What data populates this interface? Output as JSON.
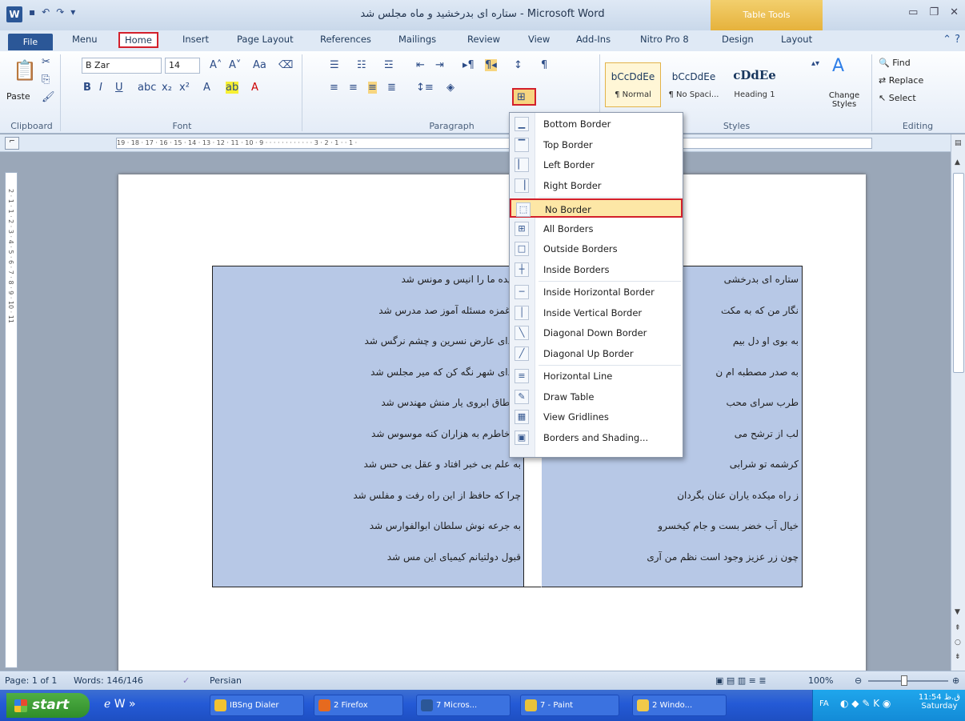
{
  "window": {
    "title": "ستاره ای بدرخشید و ماه مجلس شد - Microsoft Word",
    "app_icon": "W",
    "contextual_tab": "Table Tools"
  },
  "tabs": [
    "File",
    "Menu",
    "Home",
    "Insert",
    "Page Layout",
    "References",
    "Mailings",
    "Review",
    "View",
    "Add-Ins",
    "Nitro Pro 8",
    "Design",
    "Layout"
  ],
  "ribbon": {
    "clipboard": {
      "label": "Clipboard",
      "paste": "Paste"
    },
    "font": {
      "label": "Font",
      "font_name": "B Zar",
      "font_size": "14"
    },
    "paragraph": {
      "label": "Paragraph"
    },
    "styles": {
      "label": "Styles",
      "items": [
        {
          "sample": "bCcDdEe",
          "name": "¶ Normal"
        },
        {
          "sample": "bCcDdEe",
          "name": "¶ No Spaci..."
        },
        {
          "sample": "cDdEe",
          "name": "Heading 1"
        }
      ],
      "change_styles": "Change Styles"
    },
    "editing": {
      "label": "Editing",
      "find": "Find",
      "replace": "Replace",
      "select": "Select"
    }
  },
  "ruler": {
    "horizontal": "19 · 18 · 17 · 16 · 15 · 14 · 13 · 12 · 11 · 10 · 9 · · · · · · · · · · · · 3 · 2 · 1 · · 1 ·",
    "vertical": "2 · 1 · 1 · 2 · 3 · 4 · 5 · 6 · 7 · 8 · 9 · 10 · 11"
  },
  "document": {
    "right_column": [
      "ستاره ای بدرخشی",
      "نگار من که به مکت",
      "به بوی او دل بیم",
      "به صدر مصطبه ام ن",
      "طرب سرای محب",
      "لب از ترشح می",
      "کرشمه تو شرابی",
      "ز راه میکده یاران عنان بگردان",
      "خیال آب خضر بست و جام کیخسرو",
      "چون زر عزیز وجود است نظم من آری"
    ],
    "left_column": [
      "رمیده ما را انیس و مونس شد",
      "به غمزه مسئله آموز صد مدرس شد",
      "سدای عارض نسرین و چشم نرگس شد",
      "سدای شهر نگه کن که میر مجلس شد",
      "به طاق ابروی یار منش مهندس شد",
      "به خاطرم به هزاران کنه موسوس شد",
      "به علم بی خبر افتاد و عقل بی حس شد",
      "چرا که حافظ از این راه رفت و مفلس شد",
      "به جرعه نوش سلطان ابوالفوارس شد",
      "قبول دولتیانم کیمیای این مس شد"
    ]
  },
  "border_menu": {
    "items": [
      {
        "label": "Bottom Border",
        "icon": "border-bottom-icon",
        "glyph": "▁"
      },
      {
        "label": "Top Border",
        "icon": "border-top-icon",
        "glyph": "▔"
      },
      {
        "label": "Left Border",
        "icon": "border-left-icon",
        "glyph": "▏"
      },
      {
        "label": "Right Border",
        "icon": "border-right-icon",
        "glyph": "▕"
      },
      {
        "label": "No Border",
        "icon": "border-none-icon",
        "glyph": "⬚",
        "highlighted": true
      },
      {
        "label": "All Borders",
        "icon": "border-all-icon",
        "glyph": "⊞"
      },
      {
        "label": "Outside Borders",
        "icon": "border-outside-icon",
        "glyph": "□"
      },
      {
        "label": "Inside Borders",
        "icon": "border-inside-icon",
        "glyph": "┼"
      },
      {
        "label": "Inside Horizontal Border",
        "icon": "border-inside-horizontal-icon",
        "glyph": "─"
      },
      {
        "label": "Inside Vertical Border",
        "icon": "border-inside-vertical-icon",
        "glyph": "│"
      },
      {
        "label": "Diagonal Down Border",
        "icon": "border-diagonal-down-icon",
        "glyph": "╲"
      },
      {
        "label": "Diagonal Up Border",
        "icon": "border-diagonal-up-icon",
        "glyph": "╱"
      },
      {
        "label": "Horizontal Line",
        "icon": "horizontal-line-icon",
        "glyph": "≡"
      },
      {
        "label": "Draw Table",
        "icon": "draw-table-icon",
        "glyph": "✎"
      },
      {
        "label": "View Gridlines",
        "icon": "view-gridlines-icon",
        "glyph": "▦"
      },
      {
        "label": "Borders and Shading...",
        "icon": "borders-shading-icon",
        "glyph": "▣"
      }
    ]
  },
  "status": {
    "page": "Page: 1 of 1",
    "words": "Words: 146/146",
    "language": "Persian",
    "zoom": "100%"
  },
  "taskbar": {
    "start": "start",
    "items": [
      {
        "label": "IBSng Dialer",
        "icon": "shield-icon",
        "color": "#f2c230"
      },
      {
        "label": "2 Firefox",
        "icon": "firefox-icon",
        "color": "#e66a1f"
      },
      {
        "label": "7 Micros...",
        "icon": "word-icon",
        "color": "#2b5797"
      },
      {
        "label": "7 - Paint",
        "icon": "paint-icon",
        "color": "#e8c23a"
      },
      {
        "label": "2 Windo...",
        "icon": "folder-icon",
        "color": "#f0c94a"
      }
    ],
    "tray_lang": "FA",
    "clock_time": "11:54 ق.ظ",
    "clock_day": "Saturday"
  }
}
